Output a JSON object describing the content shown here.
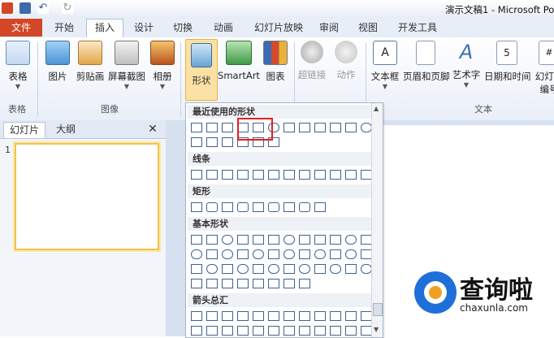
{
  "window": {
    "title": "演示文稿1 - Microsoft Po"
  },
  "tabs": [
    "开始",
    "插入",
    "设计",
    "切换",
    "动画",
    "幻灯片放映",
    "审阅",
    "视图",
    "开发工具"
  ],
  "file_tab": "文件",
  "ribbon": {
    "buttons": {
      "table": "表格",
      "picture": "图片",
      "clipart": "剪贴画",
      "screenshot": "屏幕截图",
      "album": "相册",
      "shapes": "形状",
      "smartart": "SmartArt",
      "chart": "图表",
      "hyperlink": "超链接",
      "action": "动作",
      "textbox": "文本框",
      "header_footer": "页眉和页脚",
      "wordart": "艺术字",
      "datetime": "日期和时间",
      "slide_number_1": "幻灯片",
      "slide_number_2": "编号"
    },
    "groups": {
      "table": "表格",
      "images": "图像",
      "text": "文本"
    }
  },
  "left_panel": {
    "tab_slides": "幻灯片",
    "tab_outline": "大纲",
    "close": "✕",
    "slide_number": "1"
  },
  "shapes_menu": {
    "sections": [
      "最近使用的形状",
      "线条",
      "矩形",
      "基本形状",
      "箭头总汇"
    ],
    "selected_shape": "rectangle"
  },
  "watermark": {
    "brand": "查询啦",
    "url": "chaxunla.com"
  },
  "colors": {
    "file_tab": "#d24726",
    "selection": "#e02020",
    "accent": "#1e6fd9"
  }
}
